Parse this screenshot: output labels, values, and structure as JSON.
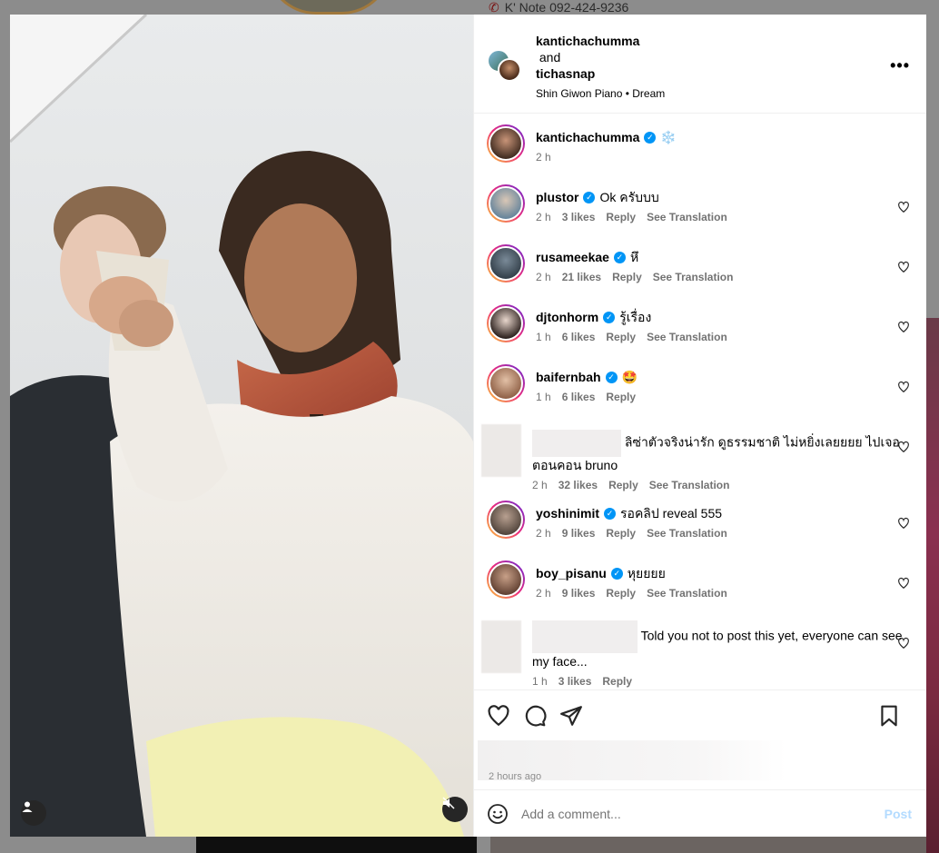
{
  "background": {
    "contact_text": "K' Note 092-424-9236"
  },
  "post": {
    "header": {
      "user1": "kantichachumma",
      "and": "and",
      "user2": "tichasnap",
      "music": "Shin Giwon Piano • Dream",
      "more_label": "•••"
    },
    "caption": {
      "user": "kantichachumma",
      "emoji": "❄️",
      "time": "2 h"
    },
    "comments": [
      {
        "user": "plustor",
        "text": "Ok ครับบบ",
        "time": "2 h",
        "likes": "3 likes",
        "reply": "Reply",
        "translate": "See Translation",
        "verified": true,
        "avatar_color": "#c9b7a8"
      },
      {
        "user": "rusameekae",
        "text": "หึ",
        "time": "2 h",
        "likes": "21 likes",
        "reply": "Reply",
        "translate": "See Translation",
        "verified": true,
        "avatar_color": "#5a6b7a"
      },
      {
        "user": "djtonhorm",
        "text": "รู้เรื่อง",
        "time": "1 h",
        "likes": "6 likes",
        "reply": "Reply",
        "translate": "See Translation",
        "verified": true,
        "avatar_color": "#3b2e2a"
      },
      {
        "user": "baifernbah",
        "text": "🤩",
        "time": "1 h",
        "likes": "6 likes",
        "reply": "Reply",
        "translate": "",
        "verified": true,
        "avatar_color": "#c89a7e"
      },
      {
        "user": "",
        "text": "ลิซ่าตัวจริงน่ารัก ดูธรรมชาติ ไม่หยิ่งเลยยยย ไปเจอตอนคอน bruno",
        "time": "2 h",
        "likes": "32 likes",
        "reply": "Reply",
        "translate": "See Translation",
        "verified": false,
        "avatar_color": ""
      },
      {
        "user": "yoshinimit",
        "text": "รอคลิป reveal 555",
        "time": "2 h",
        "likes": "9 likes",
        "reply": "Reply",
        "translate": "See Translation",
        "verified": true,
        "avatar_color": "#7a6a60"
      },
      {
        "user": "boy_pisanu",
        "text": "หุยยยย",
        "time": "2 h",
        "likes": "9 likes",
        "reply": "Reply",
        "translate": "See Translation",
        "verified": true,
        "avatar_color": "#8a6a5a"
      },
      {
        "user": "",
        "text": "Told you not to post this yet, everyone can see my face...",
        "time": "1 h",
        "likes": "3 likes",
        "reply": "Reply",
        "translate": "",
        "verified": false,
        "avatar_color": ""
      }
    ],
    "footer": {
      "time_ago": "2 hours ago",
      "comment_placeholder": "Add a comment...",
      "post_label": "Post"
    }
  },
  "colors": {
    "accent": "#0095f6",
    "post_disabled": "#b3dbff"
  }
}
